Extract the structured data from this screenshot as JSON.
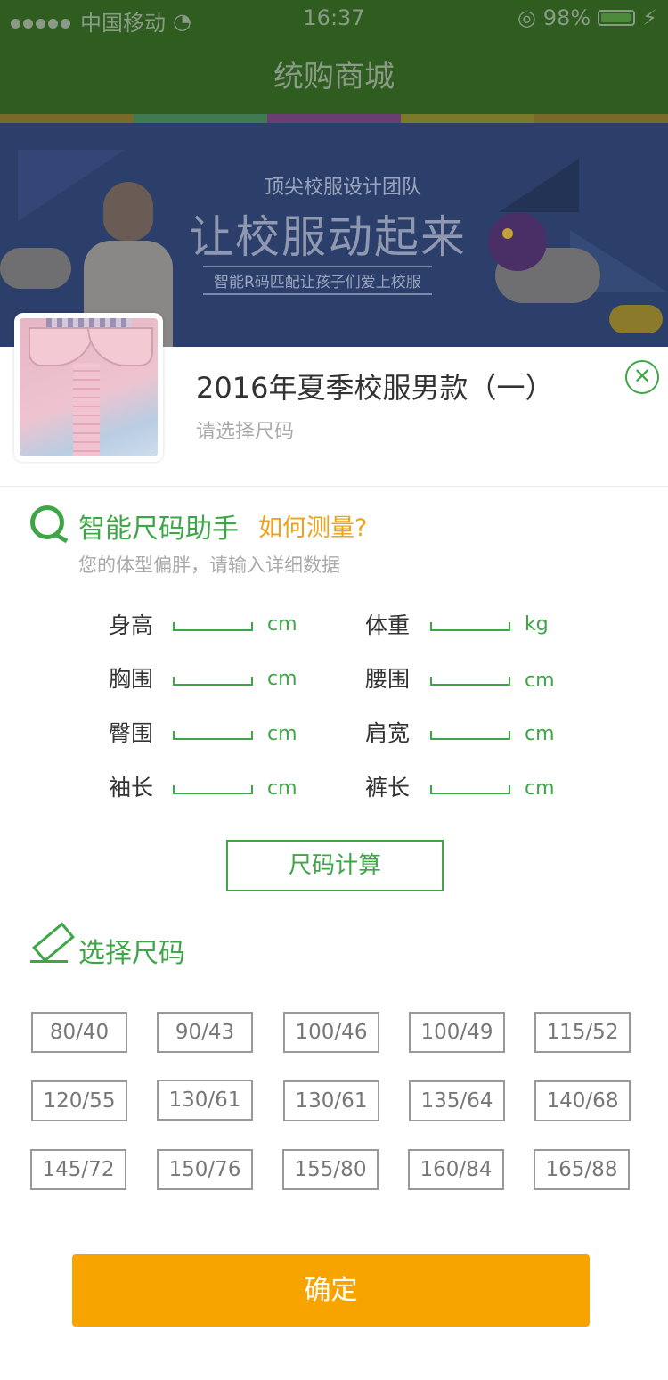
{
  "status_bar": {
    "carrier": "中国移动",
    "time": "16:37",
    "battery": "98%",
    "battery_level": 0.98
  },
  "header": {
    "title": "统购商城"
  },
  "banner": {
    "subtitle": "顶尖校服设计团队",
    "headline": "让校服动起来",
    "tagline": "智能R码匹配让孩子们爱上校服"
  },
  "product": {
    "title": "2016年夏季校服男款（一）",
    "subtitle": "请选择尺码",
    "close_icon": "close-circle-icon"
  },
  "smart": {
    "title": "智能尺码助手",
    "link": "如何测量?",
    "desc": "您的体型偏胖，请输入详细数据"
  },
  "fields": [
    {
      "label": "身高",
      "unit": "cm"
    },
    {
      "label": "体重",
      "unit": "kg"
    },
    {
      "label": "胸围",
      "unit": "cm"
    },
    {
      "label": "腰围",
      "unit": "cm"
    },
    {
      "label": "臀围",
      "unit": "cm"
    },
    {
      "label": "肩宽",
      "unit": "cm"
    },
    {
      "label": "袖长",
      "unit": "cm"
    },
    {
      "label": "裤长",
      "unit": "cm"
    }
  ],
  "calc_button": "尺码计算",
  "select_title": "选择尺码",
  "sizes": [
    "80/40",
    "90/43",
    "100/46",
    "100/49",
    "115/52",
    "120/55",
    "130/61",
    "130/61",
    "135/64",
    "140/68",
    "145/72",
    "150/76",
    "155/80",
    "160/84",
    "165/88"
  ],
  "confirm_button": "确定",
  "colors": {
    "accent_green": "#3fa648",
    "confirm_orange": "#f8a400",
    "link_orange": "#f0a21a"
  }
}
